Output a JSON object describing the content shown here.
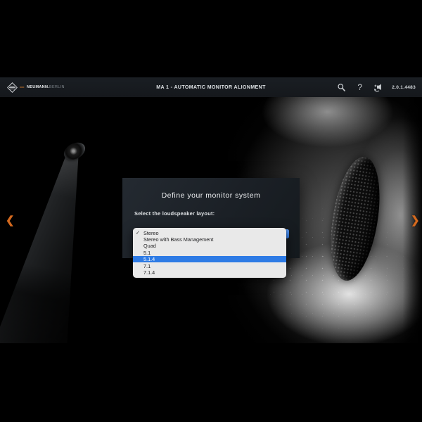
{
  "header": {
    "brand": {
      "name": "NEUMANN.",
      "suffix": "BERLIN"
    },
    "title": "MA 1 - AUTOMATIC MONITOR ALIGNMENT",
    "version": "2.0.1.4483",
    "help_glyph": "?"
  },
  "carousel": {
    "prev": "❮",
    "next": "❯"
  },
  "dialog": {
    "title": "Define your monitor system",
    "label": "Select the loudspeaker layout:"
  },
  "dropdown": {
    "checkmark": "✓",
    "items": [
      {
        "label": "Stereo",
        "checked": true,
        "selected": false
      },
      {
        "label": "Stereo with Bass Management",
        "checked": false,
        "selected": false
      },
      {
        "label": "Quad",
        "checked": false,
        "selected": false
      },
      {
        "label": "5.1",
        "checked": false,
        "selected": false
      },
      {
        "label": "5.1.4",
        "checked": false,
        "selected": true
      },
      {
        "label": "7.1",
        "checked": false,
        "selected": false
      },
      {
        "label": "7.1.4",
        "checked": false,
        "selected": false
      }
    ]
  },
  "colors": {
    "accent_orange": "#d4691e",
    "selection_blue": "#2e7be5",
    "header_bg": "#15181c",
    "menu_bg": "#e9e9e9"
  }
}
